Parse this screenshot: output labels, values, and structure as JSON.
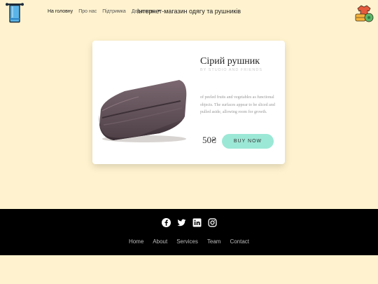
{
  "header": {
    "nav": [
      {
        "label": "На головну",
        "active": true
      },
      {
        "label": "Про нас"
      },
      {
        "label": "Підтримка"
      },
      {
        "label": "Додатково",
        "dropdown": true
      }
    ],
    "brand": "Інтернет-магазин одягу та рушників",
    "logo_left_icon": "towel-rack-icon",
    "logo_right_icon": "clothes-pile-icon"
  },
  "product": {
    "title": "Сірий рушник",
    "subtitle": "BY STUDIO AND FRIENDS",
    "description": "of peeled fruits and vegetables as functional objects. The surfaces appear to be sliced and pulled aside, allowing room for growth.",
    "price": "50₴",
    "buy_label": "BUY NOW",
    "button_color": "#9ce8d6"
  },
  "footer": {
    "social_icons": [
      "facebook-icon",
      "twitter-icon",
      "linkedin-icon",
      "instagram-icon"
    ],
    "links": [
      "Home",
      "About",
      "Services",
      "Team",
      "Contact"
    ]
  },
  "colors": {
    "background": "#fff3cf",
    "footer": "#000000"
  }
}
